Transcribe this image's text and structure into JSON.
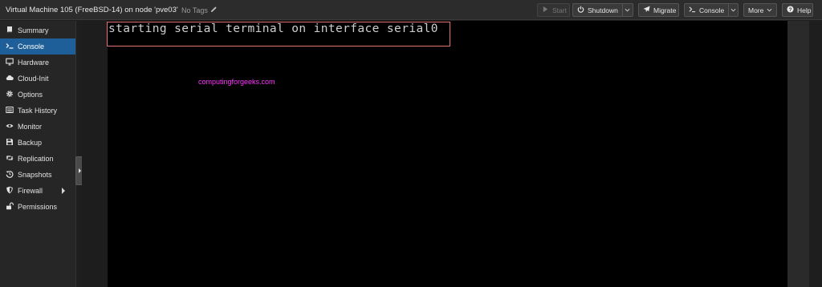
{
  "header": {
    "title": "Virtual Machine 105 (FreeBSD-14) on node 'pve03'",
    "tags_label": "No Tags"
  },
  "toolbar": {
    "start_label": "Start",
    "shutdown_label": "Shutdown",
    "migrate_label": "Migrate",
    "console_label": "Console",
    "more_label": "More",
    "help_label": "Help"
  },
  "sidebar": {
    "items": [
      {
        "label": "Summary",
        "icon": "book-icon"
      },
      {
        "label": "Console",
        "icon": "terminal-icon",
        "active": true
      },
      {
        "label": "Hardware",
        "icon": "monitor-icon"
      },
      {
        "label": "Cloud-Init",
        "icon": "cloud-icon"
      },
      {
        "label": "Options",
        "icon": "gear-icon"
      },
      {
        "label": "Task History",
        "icon": "list-icon"
      },
      {
        "label": "Monitor",
        "icon": "eye-icon"
      },
      {
        "label": "Backup",
        "icon": "floppy-icon"
      },
      {
        "label": "Replication",
        "icon": "retweet-icon"
      },
      {
        "label": "Snapshots",
        "icon": "history-icon"
      },
      {
        "label": "Firewall",
        "icon": "shield-icon"
      },
      {
        "label": "Permissions",
        "icon": "unlock-icon"
      }
    ]
  },
  "console": {
    "output_line": "starting serial terminal on interface serial0"
  },
  "watermark": "computingforgeeks.com",
  "colors": {
    "accent": "#1f5f99",
    "highlight_border": "#e57373",
    "watermark": "#ff33ff"
  }
}
